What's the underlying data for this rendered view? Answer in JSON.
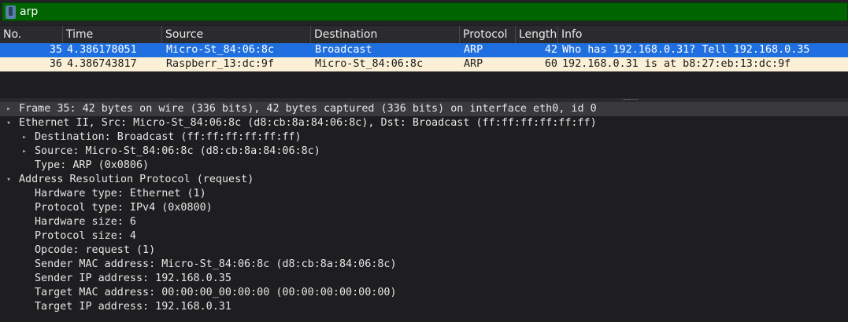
{
  "filter": {
    "value": "arp",
    "icon": "bookmark-icon"
  },
  "packet_list": {
    "columns": [
      "No.",
      "Time",
      "Source",
      "Destination",
      "Protocol",
      "Length",
      "Info"
    ],
    "rows": [
      {
        "no": "35",
        "time": "4.386178051",
        "source": "Micro-St_84:06:8c",
        "destination": "Broadcast",
        "protocol": "ARP",
        "length": "42",
        "info": "Who has 192.168.0.31? Tell 192.168.0.35"
      },
      {
        "no": "36",
        "time": "4.386743817",
        "source": "Raspberr_13:dc:9f",
        "destination": "Micro-St_84:06:8c",
        "protocol": "ARP",
        "length": "60",
        "info": "192.168.0.31 is at b8:27:eb:13:dc:9f"
      }
    ]
  },
  "details": {
    "frame": "Frame 35: 42 bytes on wire (336 bits), 42 bytes captured (336 bits) on interface eth0, id 0",
    "ethernet": "Ethernet II, Src: Micro-St_84:06:8c (d8:cb:8a:84:06:8c), Dst: Broadcast (ff:ff:ff:ff:ff:ff)",
    "eth_dst": "Destination: Broadcast (ff:ff:ff:ff:ff:ff)",
    "eth_src": "Source: Micro-St_84:06:8c (d8:cb:8a:84:06:8c)",
    "eth_type": "Type: ARP (0x0806)",
    "arp": "Address Resolution Protocol (request)",
    "arp_hw_type": "Hardware type: Ethernet (1)",
    "arp_proto_type": "Protocol type: IPv4 (0x0800)",
    "arp_hw_size": "Hardware size: 6",
    "arp_proto_size": "Protocol size: 4",
    "arp_opcode": "Opcode: request (1)",
    "arp_sender_mac": "Sender MAC address: Micro-St_84:06:8c (d8:cb:8a:84:06:8c)",
    "arp_sender_ip": "Sender IP address: 192.168.0.35",
    "arp_target_mac": "Target MAC address: 00:00:00_00:00:00 (00:00:00:00:00:00)",
    "arp_target_ip": "Target IP address: 192.168.0.31"
  },
  "colors": {
    "filter_valid": "#006400",
    "selected_row": "#1f6fe0",
    "arp_row": "#fbf0d6"
  }
}
